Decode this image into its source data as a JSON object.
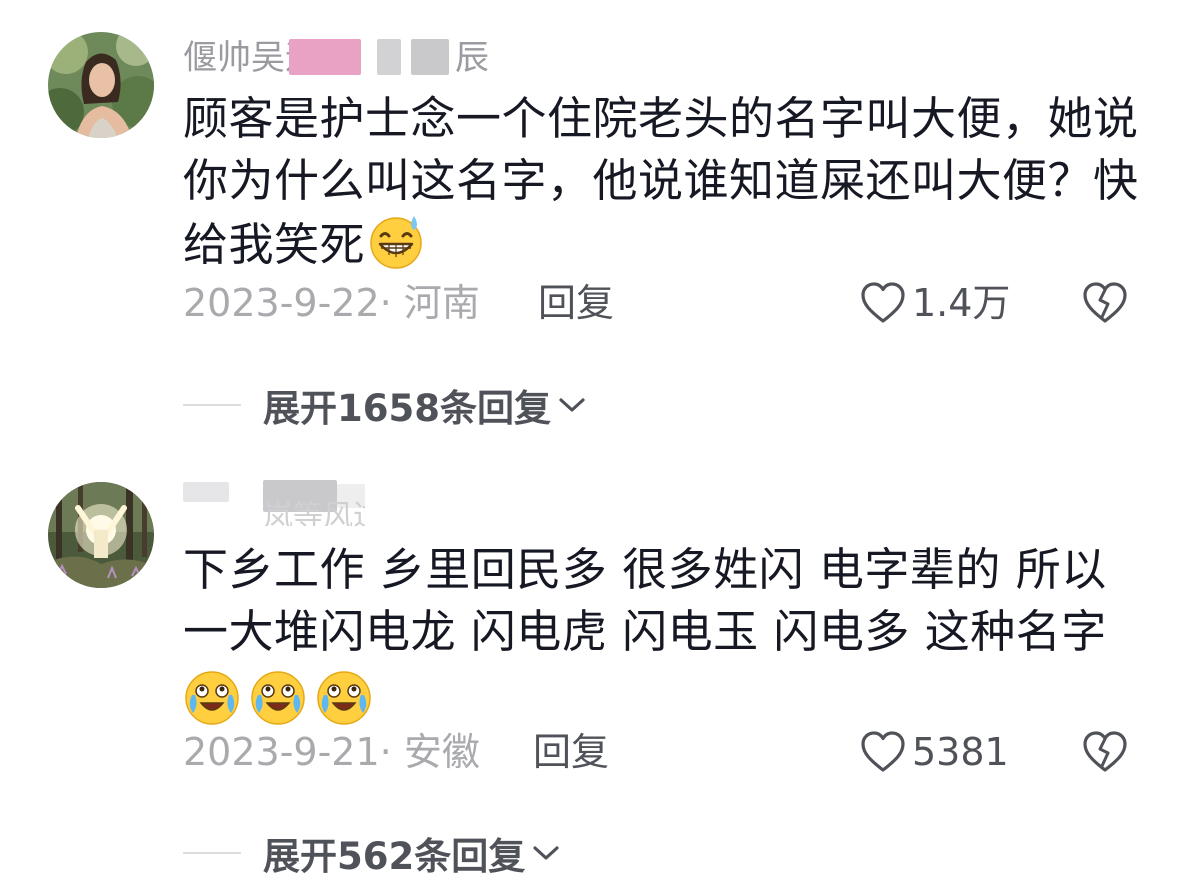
{
  "comments": [
    {
      "username": "偃帅吴迪",
      "username_tail": "辰",
      "text": "顾客是护士念一个住院老头的名字叫大便，她说你为什么叫这名字，他说谁知道屎还叫大便？快给我笑死",
      "emojis": [
        "grin-sweat-emoji"
      ],
      "date": "2023-9-22",
      "location_sep": "· ",
      "location": "河南",
      "reply_label": "回复",
      "like_count": "1.4万",
      "expand_label": "展开1658条回复"
    },
    {
      "username": "",
      "username_tail": "岚等风过_",
      "text": "下乡工作 乡里回民多 很多姓闪 电字辈的 所以一大堆闪电龙 闪电虎 闪电玉 闪电多 这种名字",
      "emojis": [
        "laugh-cry-emoji",
        "laugh-cry-emoji",
        "laugh-cry-emoji"
      ],
      "date": "2023-9-21",
      "location_sep": "· ",
      "location": "安徽",
      "reply_label": "回复",
      "like_count": "5381",
      "expand_label": "展开562条回复"
    }
  ],
  "colors": {
    "text_primary": "#161823",
    "text_secondary": "#505259",
    "text_muted": "#a9aaae",
    "username_blur_pink": "#e9a1c4",
    "username_blur_gray": "#c9c9cc"
  },
  "icons": {
    "like": "heart-outline-icon",
    "dislike": "broken-heart-icon",
    "expand": "chevron-down-icon"
  }
}
